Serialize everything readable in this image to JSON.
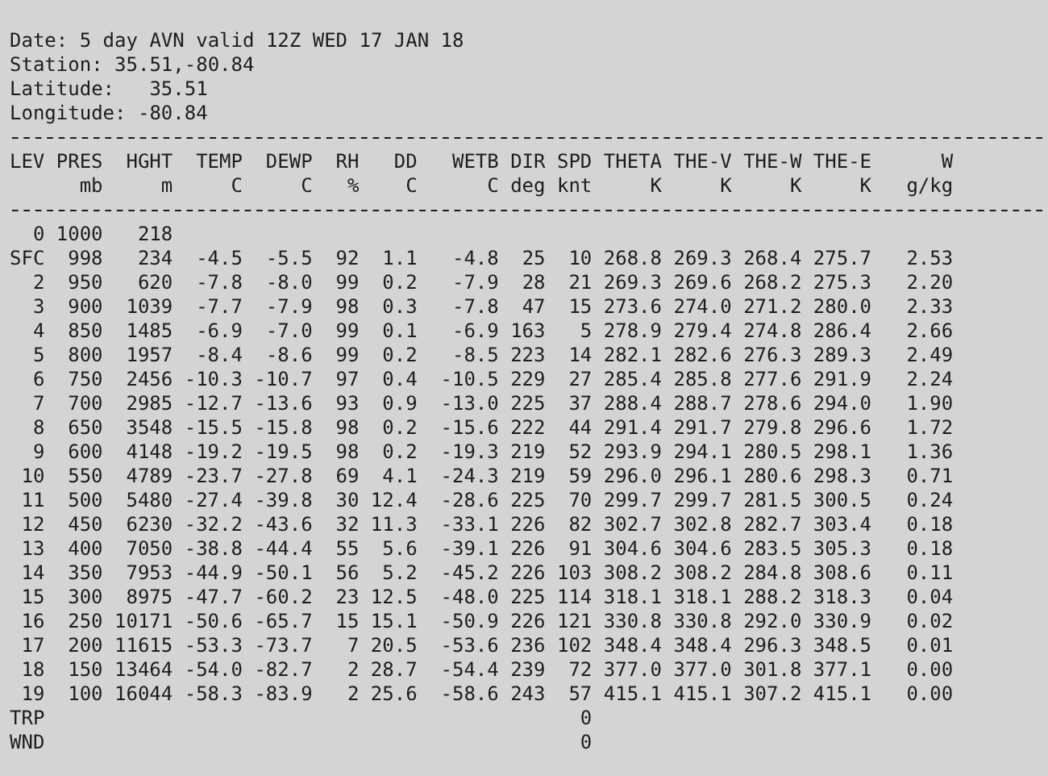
{
  "header_lines": [
    "Date: 5 day AVN valid 12Z WED 17 JAN 18",
    "Station: 35.51,-80.84",
    "Latitude:   35.51",
    "Longitude: -80.84"
  ],
  "table": {
    "columns": [
      {
        "name": "LEV"
      },
      {
        "name": "PRES",
        "unit": "mb"
      },
      {
        "name": "HGHT",
        "unit": "m"
      },
      {
        "name": "TEMP",
        "unit": "C"
      },
      {
        "name": "DEWP",
        "unit": "C"
      },
      {
        "name": "RH",
        "unit": "%"
      },
      {
        "name": "DD",
        "unit": "C"
      },
      {
        "name": "WETB",
        "unit": "C"
      },
      {
        "name": "DIR",
        "unit": "deg"
      },
      {
        "name": "SPD",
        "unit": "knt"
      },
      {
        "name": "THETA",
        "unit": "K"
      },
      {
        "name": "THE-V",
        "unit": "K"
      },
      {
        "name": "THE-W",
        "unit": "K"
      },
      {
        "name": "THE-E",
        "unit": "K"
      },
      {
        "name": "W",
        "unit": "g/kg"
      }
    ],
    "rows": [
      [
        "0",
        "1000",
        "218"
      ],
      [
        "SFC",
        "998",
        "234",
        "-4.5",
        "-5.5",
        "92",
        "1.1",
        "-4.8",
        "25",
        "10",
        "268.8",
        "269.3",
        "268.4",
        "275.7",
        "2.53"
      ],
      [
        "2",
        "950",
        "620",
        "-7.8",
        "-8.0",
        "99",
        "0.2",
        "-7.9",
        "28",
        "21",
        "269.3",
        "269.6",
        "268.2",
        "275.3",
        "2.20"
      ],
      [
        "3",
        "900",
        "1039",
        "-7.7",
        "-7.9",
        "98",
        "0.3",
        "-7.8",
        "47",
        "15",
        "273.6",
        "274.0",
        "271.2",
        "280.0",
        "2.33"
      ],
      [
        "4",
        "850",
        "1485",
        "-6.9",
        "-7.0",
        "99",
        "0.1",
        "-6.9",
        "163",
        "5",
        "278.9",
        "279.4",
        "274.8",
        "286.4",
        "2.66"
      ],
      [
        "5",
        "800",
        "1957",
        "-8.4",
        "-8.6",
        "99",
        "0.2",
        "-8.5",
        "223",
        "14",
        "282.1",
        "282.6",
        "276.3",
        "289.3",
        "2.49"
      ],
      [
        "6",
        "750",
        "2456",
        "-10.3",
        "-10.7",
        "97",
        "0.4",
        "-10.5",
        "229",
        "27",
        "285.4",
        "285.8",
        "277.6",
        "291.9",
        "2.24"
      ],
      [
        "7",
        "700",
        "2985",
        "-12.7",
        "-13.6",
        "93",
        "0.9",
        "-13.0",
        "225",
        "37",
        "288.4",
        "288.7",
        "278.6",
        "294.0",
        "1.90"
      ],
      [
        "8",
        "650",
        "3548",
        "-15.5",
        "-15.8",
        "98",
        "0.2",
        "-15.6",
        "222",
        "44",
        "291.4",
        "291.7",
        "279.8",
        "296.6",
        "1.72"
      ],
      [
        "9",
        "600",
        "4148",
        "-19.2",
        "-19.5",
        "98",
        "0.2",
        "-19.3",
        "219",
        "52",
        "293.9",
        "294.1",
        "280.5",
        "298.1",
        "1.36"
      ],
      [
        "10",
        "550",
        "4789",
        "-23.7",
        "-27.8",
        "69",
        "4.1",
        "-24.3",
        "219",
        "59",
        "296.0",
        "296.1",
        "280.6",
        "298.3",
        "0.71"
      ],
      [
        "11",
        "500",
        "5480",
        "-27.4",
        "-39.8",
        "30",
        "12.4",
        "-28.6",
        "225",
        "70",
        "299.7",
        "299.7",
        "281.5",
        "300.5",
        "0.24"
      ],
      [
        "12",
        "450",
        "6230",
        "-32.2",
        "-43.6",
        "32",
        "11.3",
        "-33.1",
        "226",
        "82",
        "302.7",
        "302.8",
        "282.7",
        "303.4",
        "0.18"
      ],
      [
        "13",
        "400",
        "7050",
        "-38.8",
        "-44.4",
        "55",
        "5.6",
        "-39.1",
        "226",
        "91",
        "304.6",
        "304.6",
        "283.5",
        "305.3",
        "0.18"
      ],
      [
        "14",
        "350",
        "7953",
        "-44.9",
        "-50.1",
        "56",
        "5.2",
        "-45.2",
        "226",
        "103",
        "308.2",
        "308.2",
        "284.8",
        "308.6",
        "0.11"
      ],
      [
        "15",
        "300",
        "8975",
        "-47.7",
        "-60.2",
        "23",
        "12.5",
        "-48.0",
        "225",
        "114",
        "318.1",
        "318.1",
        "288.2",
        "318.3",
        "0.04"
      ],
      [
        "16",
        "250",
        "10171",
        "-50.6",
        "-65.7",
        "15",
        "15.1",
        "-50.9",
        "226",
        "121",
        "330.8",
        "330.8",
        "292.0",
        "330.9",
        "0.02"
      ],
      [
        "17",
        "200",
        "11615",
        "-53.3",
        "-73.7",
        "7",
        "20.5",
        "-53.6",
        "236",
        "102",
        "348.4",
        "348.4",
        "296.3",
        "348.5",
        "0.01"
      ],
      [
        "18",
        "150",
        "13464",
        "-54.0",
        "-82.7",
        "2",
        "28.7",
        "-54.4",
        "239",
        "72",
        "377.0",
        "377.0",
        "301.8",
        "377.1",
        "0.00"
      ],
      [
        "19",
        "100",
        "16044",
        "-58.3",
        "-83.9",
        "2",
        "25.6",
        "-58.6",
        "243",
        "57",
        "415.1",
        "415.1",
        "307.2",
        "415.1",
        "0.00"
      ],
      [
        "TRP",
        null,
        null,
        null,
        null,
        null,
        null,
        null,
        null,
        "0"
      ],
      [
        "WND",
        null,
        null,
        null,
        null,
        null,
        null,
        null,
        null,
        "0"
      ]
    ]
  }
}
